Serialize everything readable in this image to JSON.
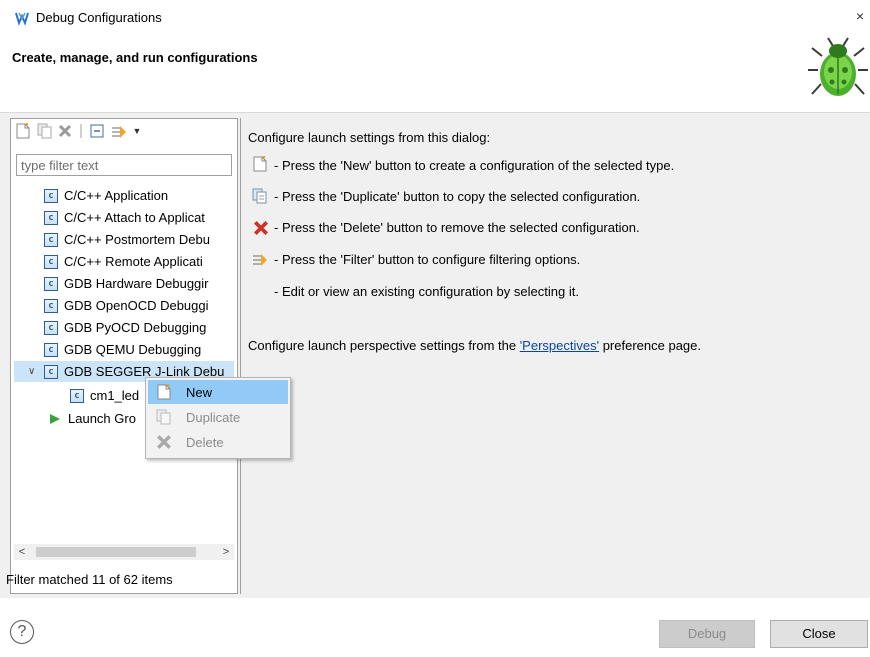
{
  "window": {
    "title": "Debug Configurations",
    "close_glyph": "×"
  },
  "banner": {
    "title": "Create, manage, and run configurations"
  },
  "filter": {
    "placeholder": "type filter text",
    "status": "Filter matched 11 of 62 items"
  },
  "tree": {
    "items": [
      {
        "label": "C/C++ Application",
        "icon": "c-config-icon"
      },
      {
        "label": "C/C++ Attach to Applicat",
        "icon": "c-config-icon"
      },
      {
        "label": "C/C++ Postmortem Debu",
        "icon": "c-config-icon"
      },
      {
        "label": "C/C++ Remote Applicati",
        "icon": "c-config-icon"
      },
      {
        "label": "GDB Hardware Debuggir",
        "icon": "c-config-icon"
      },
      {
        "label": "GDB OpenOCD Debuggi",
        "icon": "c-config-icon"
      },
      {
        "label": "GDB PyOCD Debugging",
        "icon": "c-config-icon"
      },
      {
        "label": "GDB QEMU Debugging",
        "icon": "c-config-icon"
      },
      {
        "label": "GDB SEGGER J-Link Debu",
        "icon": "c-config-icon",
        "expanded": true,
        "selected": true
      },
      {
        "label": "cm1_led",
        "icon": "c-config-icon",
        "child": true
      },
      {
        "label": "Launch Gro",
        "icon": "launch-group-icon"
      }
    ]
  },
  "context_menu": {
    "items": [
      {
        "label": "New",
        "enabled": true,
        "highlighted": true,
        "icon": "new-config-icon"
      },
      {
        "label": "Duplicate",
        "enabled": false,
        "icon": "duplicate-icon"
      },
      {
        "label": "Delete",
        "enabled": false,
        "icon": "delete-icon"
      }
    ]
  },
  "help": {
    "intro": "Configure launch settings from this dialog:",
    "lines": [
      {
        "icon": "new-config-icon",
        "text": "- Press the 'New' button to create a configuration of the selected type."
      },
      {
        "icon": "duplicate-icon",
        "text": "- Press the 'Duplicate' button to copy the selected configuration."
      },
      {
        "icon": "delete-icon",
        "text": "- Press the 'Delete' button to remove the selected configuration."
      },
      {
        "icon": "filter-icon",
        "text": "- Press the 'Filter' button to configure filtering options."
      },
      {
        "icon": "",
        "text": "- Edit or view an existing configuration by selecting it."
      }
    ],
    "perspective_prefix": "Configure launch perspective settings from the ",
    "perspective_link": "'Perspectives'",
    "perspective_suffix": " preference page."
  },
  "scrollbar": {
    "left_arrow": "<",
    "right_arrow": ">"
  },
  "buttons": {
    "help": "?",
    "debug": "Debug",
    "close": "Close"
  },
  "colors": {
    "selection": "#cce4f7",
    "menu_highlight": "#91c9f7",
    "link": "#0645ad",
    "delete_red": "#d0312d"
  }
}
